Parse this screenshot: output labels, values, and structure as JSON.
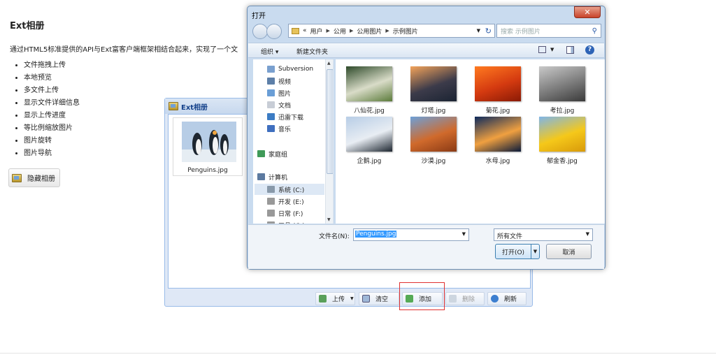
{
  "page": {
    "title": "Ext相册",
    "description": "通过HTML5标准提供的API与Ext富客户端框架相结合起来，实现了一个文",
    "features": [
      "文件拖拽上传",
      "本地预览",
      "多文件上传",
      "显示文件详细信息",
      "显示上传进度",
      "等比例缩放图片",
      "图片旋转",
      "图片导航"
    ],
    "hide_album_button": "隐藏相册"
  },
  "album_window": {
    "title": "Ext相册",
    "images": [
      {
        "caption": "Penguins.jpg"
      }
    ],
    "toolbar": {
      "upload": "上传",
      "clear": "清空",
      "add": "添加",
      "delete": "删除",
      "refresh": "刷新"
    }
  },
  "dialog": {
    "title": "打开",
    "close_glyph": "✕",
    "address_path": [
      "«",
      "用户",
      "公用",
      "公用图片",
      "示例图片"
    ],
    "search_placeholder": "搜索 示例图片",
    "commands": {
      "organize": "组织 ▾",
      "new_folder": "新建文件夹"
    },
    "nav_items": [
      {
        "label": "Subversion",
        "color": "#7aa0cf"
      },
      {
        "label": "视频",
        "color": "#5d7fa8"
      },
      {
        "label": "图片",
        "color": "#6a9ed6"
      },
      {
        "label": "文档",
        "color": "#c8cdd6"
      },
      {
        "label": "迅雷下载",
        "color": "#3c7cc4"
      },
      {
        "label": "音乐",
        "color": "#3f6fbf"
      },
      {
        "label": "家庭组",
        "color": "#3f9a58"
      },
      {
        "label": "计算机",
        "color": "#5c7aa0"
      },
      {
        "label": "系统 (C:)",
        "color": "#8899aa"
      },
      {
        "label": "开发 (E:)",
        "color": "#999999"
      },
      {
        "label": "日常 (F:)",
        "color": "#999999"
      },
      {
        "label": "工具 (G:)",
        "color": "#999999"
      }
    ],
    "files": [
      {
        "name": "八仙花.jpg",
        "colors": [
          "#2e4a2a",
          "#d9dcc8",
          "#5b7b3a"
        ]
      },
      {
        "name": "灯塔.jpg",
        "colors": [
          "#f3a35a",
          "#3c3b4a",
          "#1b2433"
        ]
      },
      {
        "name": "菊花.jpg",
        "colors": [
          "#ff7a20",
          "#d43a10",
          "#8a1a05"
        ]
      },
      {
        "name": "考拉.jpg",
        "colors": [
          "#c9c9c9",
          "#7b7b7b",
          "#3a3a3a"
        ]
      },
      {
        "name": "企鹅.jpg",
        "colors": [
          "#b7cde6",
          "#e8edf3",
          "#1d2630"
        ]
      },
      {
        "name": "沙漠.jpg",
        "colors": [
          "#6da0d8",
          "#d06a2c",
          "#8a3a15"
        ]
      },
      {
        "name": "水母.jpg",
        "colors": [
          "#0d2a5c",
          "#f0a040",
          "#0a1a3a"
        ]
      },
      {
        "name": "郁金香.jpg",
        "colors": [
          "#7fb5e8",
          "#f5c81a",
          "#d89a0a"
        ]
      }
    ],
    "filename_label": "文件名(N):",
    "filename_value": "Penguins.jpg",
    "file_type": "所有文件",
    "open_button": "打开(O)",
    "cancel_button": "取消"
  }
}
